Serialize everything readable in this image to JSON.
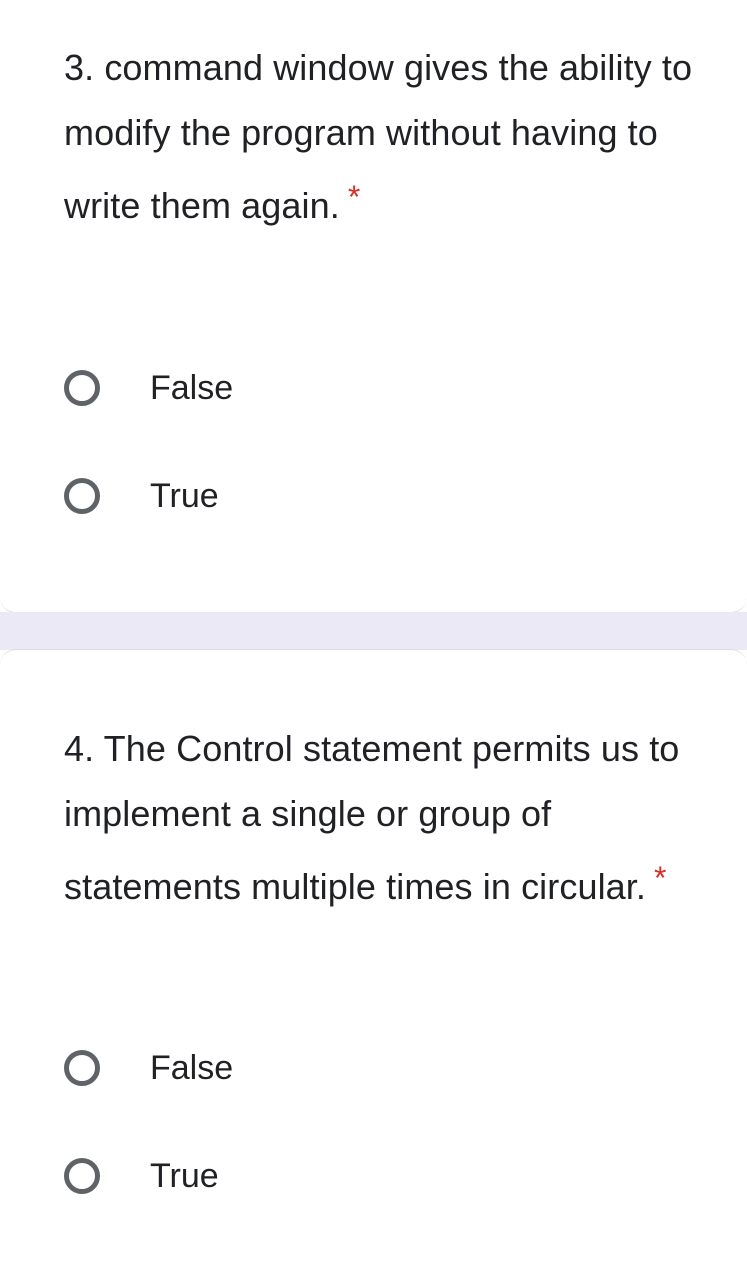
{
  "questions": [
    {
      "number": "3.",
      "text": "3. command window gives the ability to modify the program without having to write them again.",
      "required_marker": "*",
      "options": [
        {
          "label": "False",
          "selected": false
        },
        {
          "label": "True",
          "selected": false
        }
      ]
    },
    {
      "number": "4.",
      "text": "4. The Control statement permits us to implement a single or group of statements multiple times in circular.",
      "required_marker": "*",
      "options": [
        {
          "label": "False",
          "selected": false
        },
        {
          "label": "True",
          "selected": false
        }
      ]
    }
  ],
  "colors": {
    "required": "#d93025",
    "radio_border": "#5f6368",
    "separator": "#ece9f6",
    "text": "#202124"
  }
}
